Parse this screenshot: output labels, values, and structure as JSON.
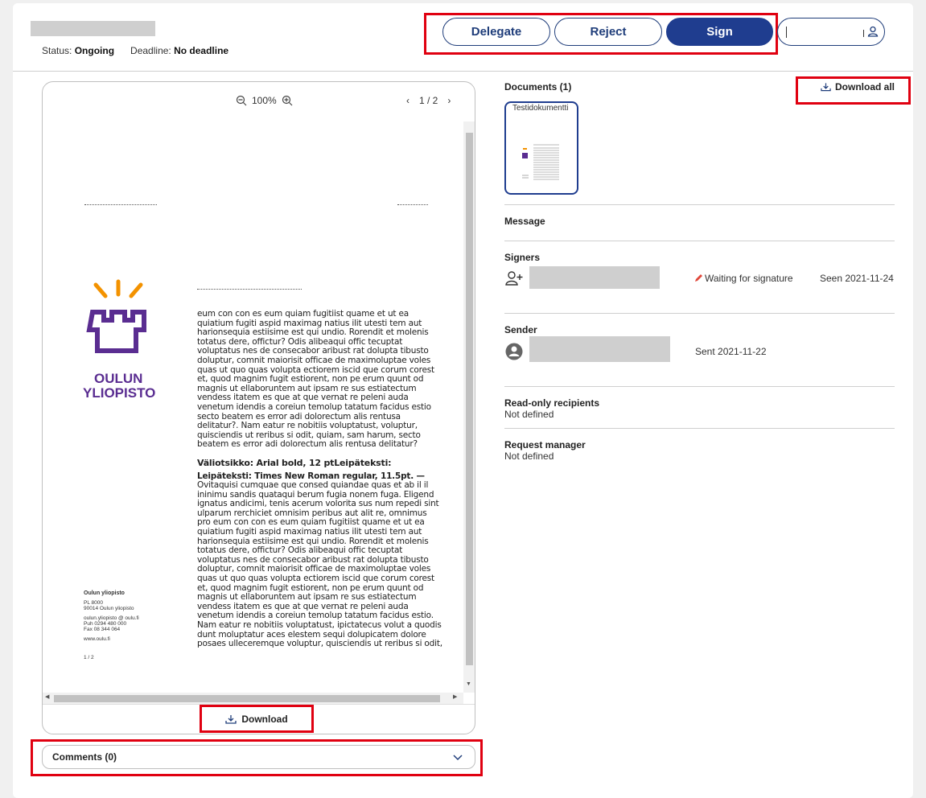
{
  "header": {
    "status_label": "Status:",
    "status_value": "Ongoing",
    "deadline_label": "Deadline:",
    "deadline_value": "No deadline"
  },
  "actions": {
    "delegate": "Delegate",
    "reject": "Reject",
    "sign": "Sign"
  },
  "viewer": {
    "zoom": "100%",
    "page": "1 / 2",
    "download": "Download"
  },
  "document": {
    "logo_line1": "OULUN",
    "logo_line2": "YLIOPISTO",
    "body1": "eum con con es eum quiam fugitiist quame et ut ea quiatium fugiti aspid maximag natius ilit utesti tem aut harionsequia estiisime est qui undio. Rorendit et molenis totatus dere, offictur? Odis alibeaqui offic tecuptat voluptatus nes de consecabor aribust rat dolupta tibusto doluptur, comnit maiorisit officae de maximoluptae voles quas ut quo quas volupta ectiorem iscid que corum corest et, quod magnim fugit estiorent, non pe erum quunt od magnis ut ellaboruntem aut ipsam re sus estiatectum vendess itatem es que at que vernat re peleni auda venetum idendis a coreiun temolup tatatum facidus estio secto beatem es error adi dolorectum alis rentusa delitatur?. Nam eatur re nobitiis voluptatust, voluptur, quisciendis ut reribus si odit, quiam, sam harum, secto beatem es error adi dolorectum alis rentusa delitatur?",
    "heading": "Väliotsikko: Arial bold, 12 ptLeipäteksti:",
    "subheading": "Leipäteksti: Times New Roman regular, 11.5pt. —",
    "body2": "Ovitaquisi cumquae que consed quiandae quas et ab il il ininimu sandis quataqui berum fugia nonem fuga. Eligend ignatus andicimi, tenis acerum volorita sus num repedi sint ulparum rerchiciet omnisim peribus aut alit re, omnimus pro eum con con es eum quiam fugitiist quame et ut ea quiatium fugiti aspid maximag natius ilit utesti tem aut harionsequia estiisime est qui undio. Rorendit et molenis totatus dere, offictur? Odis alibeaqui offic tecuptat voluptatus nes de consecabor aribust rat dolupta tibusto doluptur, comnit maiorisit officae de maximoluptae voles quas ut quo quas volupta ectiorem iscid que corum corest et, quod magnim fugit estiorent, non pe erum quunt od magnis ut ellaboruntem aut ipsam re sus estiatectum vendess itatem es que at que vernat re peleni auda venetum idendis a coreiun temolup tatatum facidus estio. Nam eatur re nobitiis voluptatust, ipictatecus volut a quodis dunt moluptatur aces elestem sequi dolupicatem dolore posaes ulleceremque voluptur, quisciendis ut reribus si odit,",
    "footer_org": "Oulun yliopisto",
    "footer_addr1": "PL 8000",
    "footer_addr2": "90014 Oulun yliopisto",
    "footer_email": "oulun.yliopisto @ oulu.fi",
    "footer_phone": "Puh 0294 480 000",
    "footer_fax": "Fax 08 344 064",
    "footer_web": "www.oulu.fi",
    "footer_page": "1 / 2"
  },
  "comments": {
    "label": "Comments (0)"
  },
  "documents": {
    "title": "Documents (1)",
    "download_all": "Download all",
    "thumb_label": "Testidokumentti"
  },
  "message": {
    "title": "Message"
  },
  "signers": {
    "title": "Signers",
    "status": "Waiting for signature",
    "seen": "Seen 2021-11-24"
  },
  "sender": {
    "title": "Sender",
    "sent": "Sent 2021-11-22"
  },
  "readonly": {
    "title": "Read-only recipients",
    "value": "Not defined"
  },
  "manager": {
    "title": "Request manager",
    "value": "Not defined"
  },
  "colors": {
    "accent": "#1f3d8f",
    "logo_purple": "#5a2d91",
    "logo_orange": "#f39200",
    "highlight": "#e00010"
  }
}
